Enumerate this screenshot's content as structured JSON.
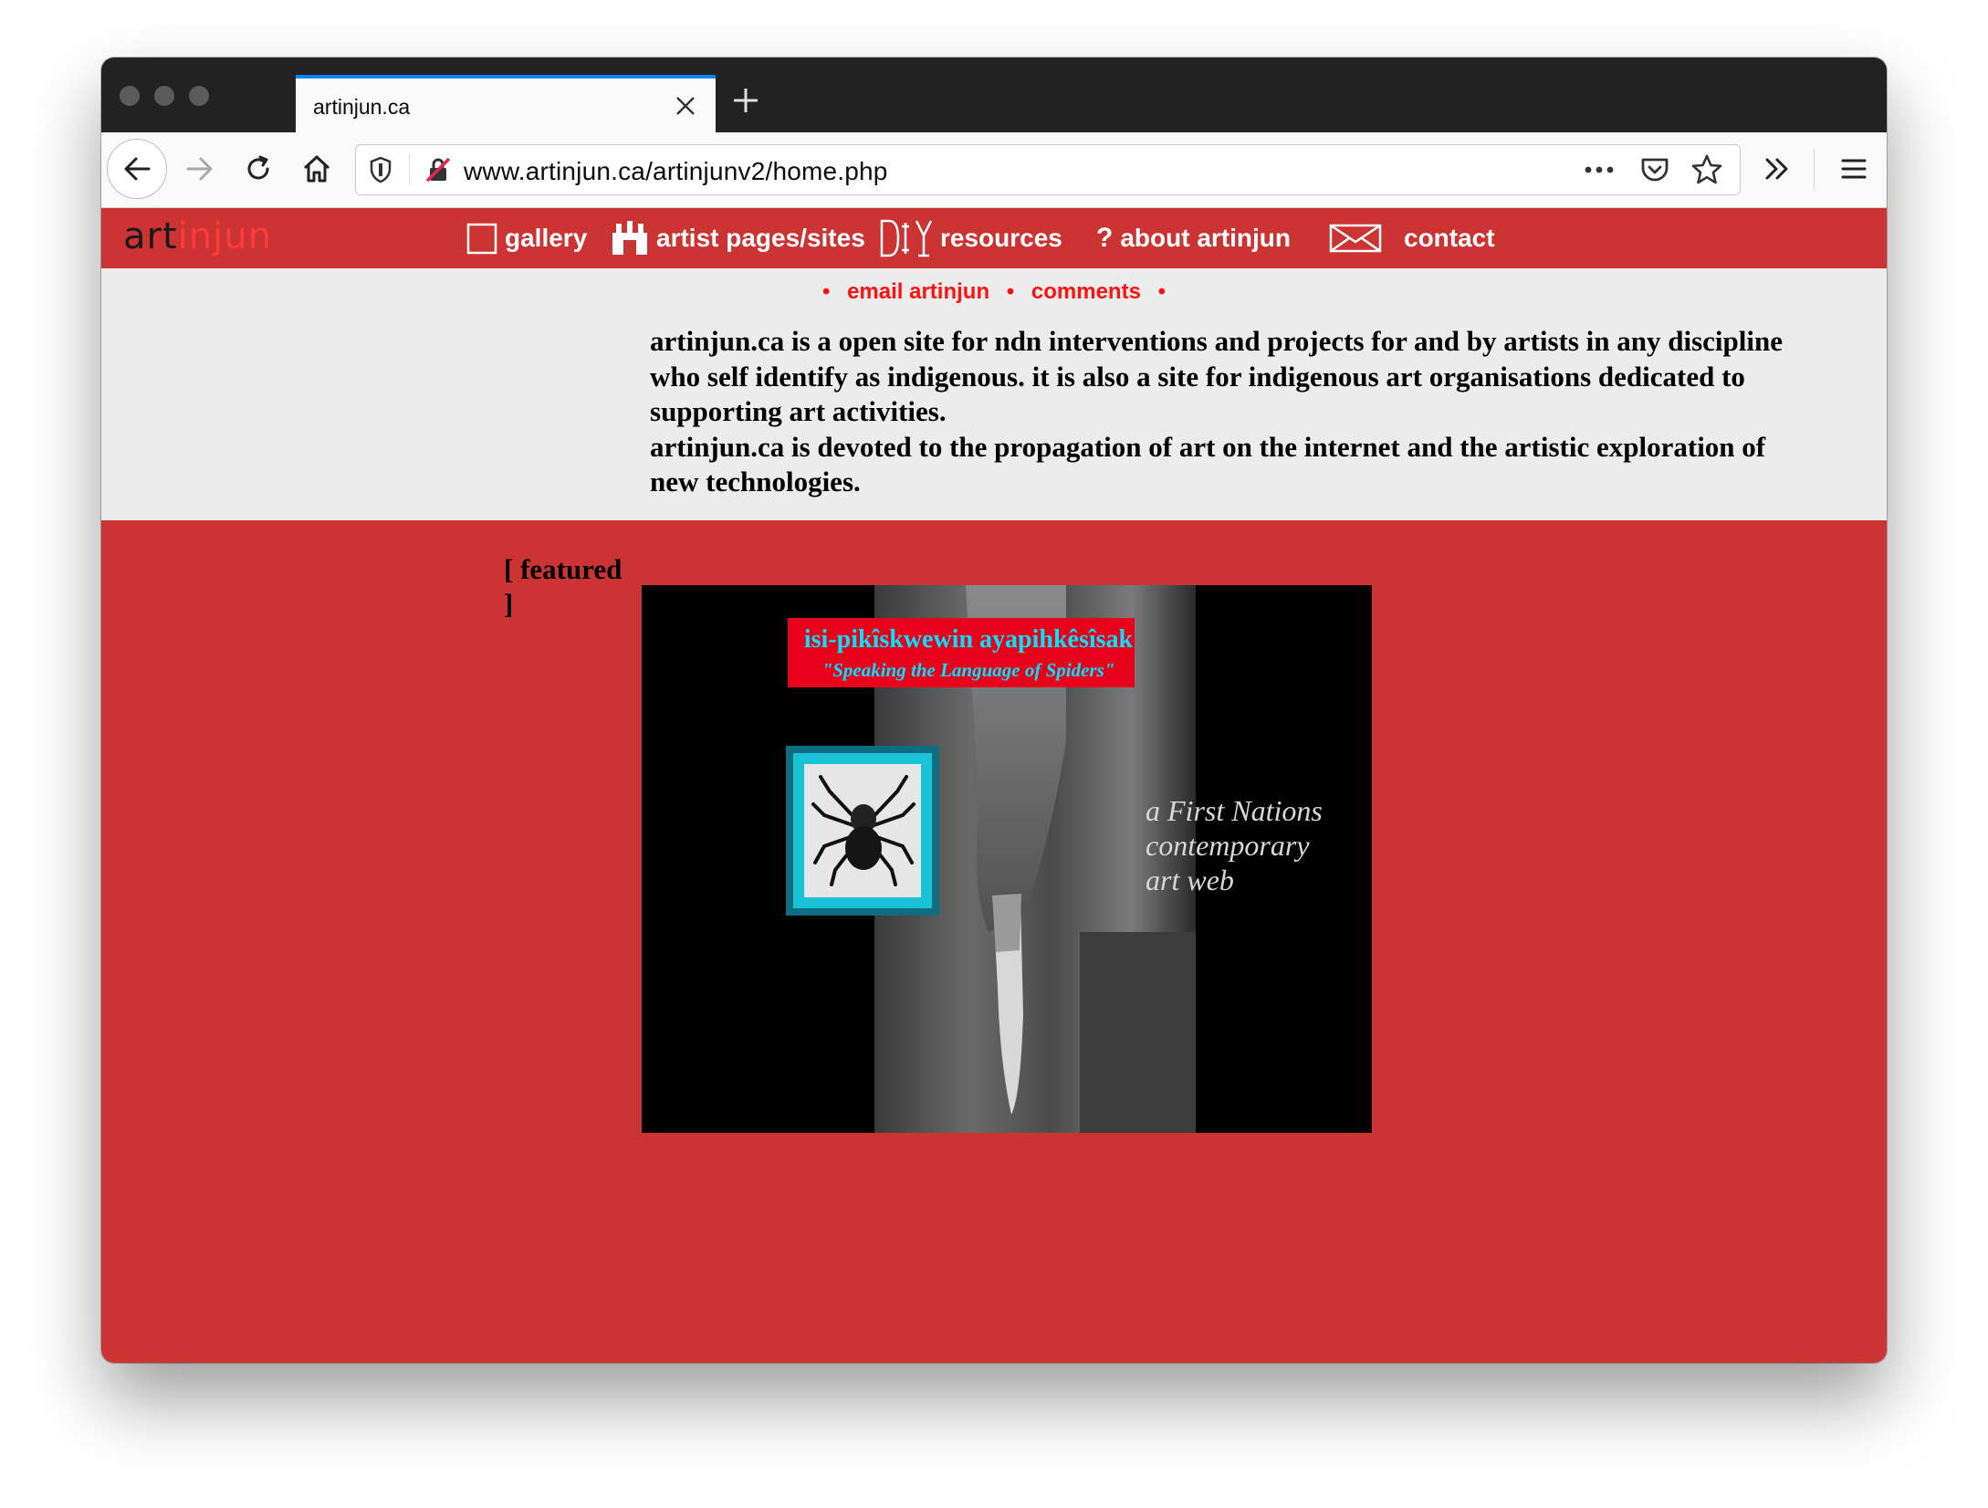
{
  "browser": {
    "tab_title": "artinjun.ca",
    "url": "www.artinjun.ca/artinjunv2/home.php"
  },
  "site": {
    "logo": {
      "part1": "art",
      "part2": "injun"
    },
    "nav": [
      "gallery",
      "artist pages/sites",
      "resources",
      "about artinjun",
      "contact"
    ],
    "subnav": [
      "email artinjun",
      "comments"
    ],
    "subnav_bullet": "•",
    "intro": [
      "artinjun.ca is a open site for ndn interventions and projects for and by artists in any discipline who self identify as indigenous. it is also a site for indigenous art organisations dedicated to supporting art activities.",
      "artinjun.ca is devoted to the propagation of art on the internet and the artistic exploration of new technologies."
    ],
    "featured_label": "[ featured ]",
    "featured_image": {
      "title": "isi-pikîskwewin ayapihkêsîsak",
      "subtitle": "\"Speaking the Language of Spiders\"",
      "caption_lines": [
        "a First Nations",
        "contemporary",
        "art web"
      ]
    }
  },
  "colors": {
    "site_red": "#cc3333",
    "logo_red": "#ff3a3a",
    "subnav_red": "#ff1111",
    "page_gray": "#ececec",
    "image_title_cyan": "#00e5ff"
  }
}
